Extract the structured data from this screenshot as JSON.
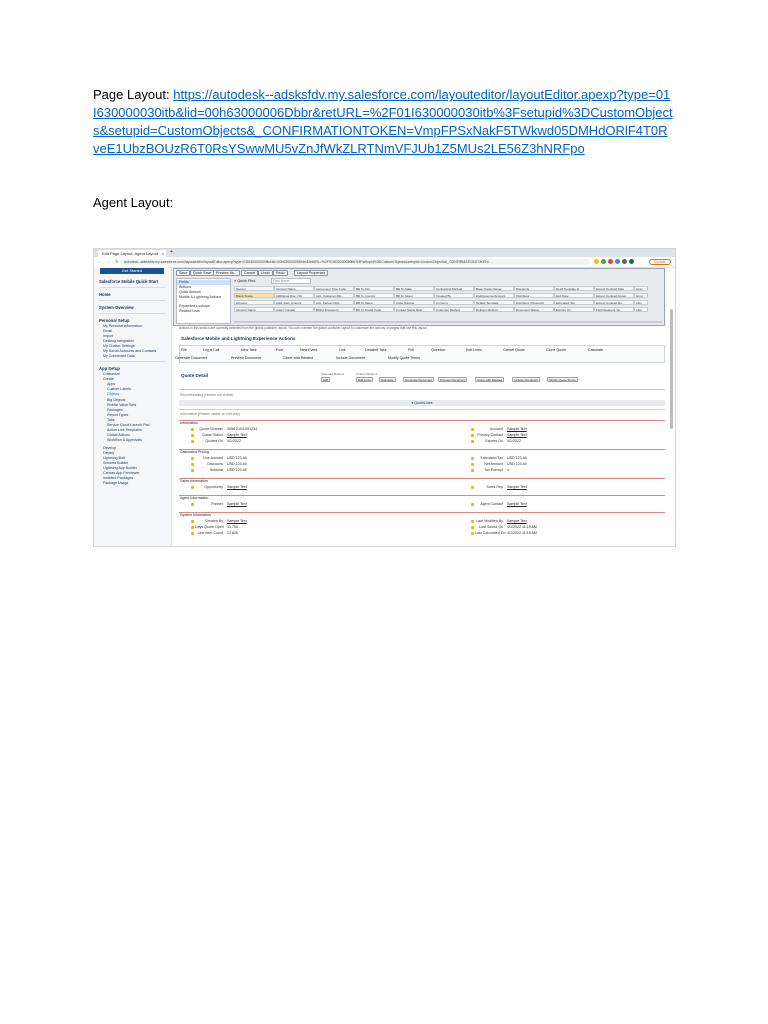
{
  "doc": {
    "page_layout_label": "Page Layout:",
    "page_layout_url": "https://autodesk--adsksfdv.my.salesforce.com/layouteditor/layoutEditor.apexp?type=01I630000030itb&lid=00h63000006Dbbr&retURL=%2F01I630000030itb%3Fsetupid%3DCustomObjects&setupid=CustomObjects&_CONFIRMATIONTOKEN=VmpFPSxNakF5TWkwd05DMHdORlF4T0RveE1UbzBOUzR6T0RsYSwwMU5vZnJfWkZLRTNmVFJUb1Z5MUs2LE56Z3hNRFpo",
    "agent_layout_label": "Agent Layout:"
  },
  "screenshot": {
    "tab_title": "Edit Page Layout: Agent Layout",
    "url": "autodesk--adsksfdv.my.salesforce.com/layouteditor/layoutEditor.apexp?type=01I630000030itb&lid=00h63000006Dbbr&retURL=%2F01I630000030itb%3Fsetupid%3DCustomObjects&setupid=CustomObjects&_CONFIRMATIONTOKEN=...",
    "update_label": "Update",
    "sidebar": {
      "get_started": "Get Started",
      "mobile_quick_start": "Salesforce Mobile Quick Start",
      "home": "Home",
      "system_overview": "System Overview",
      "personal_setup": "Personal Setup",
      "personal_items": [
        "My Personal Information",
        "Email",
        "Import",
        "Desktop Integration",
        "My Chatter Settings",
        "My Social Accounts and Contacts",
        "My Connected Data"
      ],
      "app_setup": "App Setup",
      "app_items": [
        "Customize",
        "Create"
      ],
      "create_items": [
        "Apps",
        "Custom Labels",
        "Objects",
        "Big Objects",
        "Picklist Value Sets",
        "Packages",
        "Report Types",
        "Tabs",
        "Service Cloud Launch Pad",
        "Action Link Templates",
        "Global Actions",
        "Workflow & Approvals"
      ],
      "more_items": [
        "Develop",
        "Deploy",
        "Lightning Bolt",
        "Schema Builder",
        "Lightning App Builder",
        "Canvas App Previewer",
        "Installed Packages",
        "Package Usage"
      ]
    },
    "palette": {
      "toolbar": [
        "Save",
        "Quick Save",
        "Preview As...",
        "Cancel",
        "Undo",
        "Redo",
        "Layout Properties"
      ],
      "categories": [
        "Fields",
        "Buttons",
        "Quick Actions",
        "Mobile & Lightning Actions",
        "Expanded Lookups",
        "Related Lists"
      ],
      "quick_find_label": "Quick Find",
      "quick_find_placeholder": "Field Name",
      "fields": [
        [
          "Section",
          "Account Name",
          "Agreement Type Code",
          "Bill To City",
          "Bill To State",
          "Contracting Method",
          "Base Quote Owner",
          "Discounts",
          "Doc# Template Id",
          "Expect Contract Flag",
          "Gran"
        ],
        [
          "Blank Space",
          "Additional Disc. (%)",
          "Avg. Customer Dis...",
          "Bill To Country",
          "Bill To Street",
          "Created By",
          "EndCustomerAccount",
          "Distributor",
          "End Date",
          "Expect Contract Notes",
          "Grou"
        ],
        [
          "Account",
          "Addl. Disc. Amount",
          "Avg. Partner Disc...",
          "Bill To Name",
          "Case Number",
          "Currency",
          "Default Template",
          "Distributor (Discount)",
          "Estimated Tax",
          "Expect Contract Ru...",
          "Inbo"
        ],
        [
          "Account Name",
          "Agent Contact",
          "Billing Frequency",
          "Bill To Postal Code",
          "Contact Name Rest...",
          "Customer Method",
          "Delivery Method",
          "Document Status",
          "Expires On",
          "Field Segment Ter...",
          "Inbo"
        ]
      ]
    },
    "info_banner": "Actions in this section are currently inherited from the global publisher layout. You can override the global publisher layout to customize the actions on pages that use this layout.",
    "actions_title": "Salesforce Mobile and Lightning Experience Actions",
    "actions_row1": [
      "File",
      "Log a Call",
      "New Task",
      "Post",
      "New Event",
      "Link",
      "Detailed Task",
      "Poll",
      "Question",
      "Edit Lines",
      "Cancel Quote",
      "Clone Quote",
      "Calculate"
    ],
    "actions_row2": [
      "Generate Document",
      "Preview Document",
      "Clone with Related",
      "Include Document",
      "Modify Quote Terms"
    ],
    "quote_detail_title": "Quote Detail",
    "standard_buttons_label": "Standard Buttons",
    "custom_buttons_label": "Custom Buttons",
    "standard_buttons": [
      "Edit"
    ],
    "custom_buttons": [
      "Edit Lines",
      "Calculate",
      "Generate Document",
      "Preview Document",
      "Clone with Related",
      "Include Document",
      "Modify Quote Terms"
    ],
    "section_unnamed": "Recordheading (Header not visible)",
    "quotelines_bar": "QuoteLines",
    "section_info_hidden": "Information (Header visible on edit only)",
    "sections": [
      {
        "title": "Information",
        "left": [
          [
            "Quote Number",
            "0096 2104-001234"
          ],
          [
            "Quote Status",
            "Sample Text"
          ],
          [
            "Quoted On",
            "4/1/2022"
          ]
        ],
        "right": [
          [
            "Account",
            "Sample Text"
          ],
          [
            "Primary Contact",
            "Sample Text"
          ],
          [
            "Expires On",
            "4/1/2022"
          ]
        ]
      },
      {
        "title": "Calculated Pricing",
        "left": [
          [
            "Line Amount",
            "USD 123.45"
          ],
          [
            "Discounts",
            "USD 123.45"
          ],
          [
            "Subtotal",
            "USD 123.45"
          ]
        ],
        "right": [
          [
            "Estimated Tax",
            "USD 123.45"
          ],
          [
            "Net Amount",
            "USD 123.45"
          ],
          [
            "Tax Exempt",
            "✔"
          ]
        ]
      },
      {
        "title": "Sales Information",
        "left": [
          [
            "Opportunity",
            "Sample Text"
          ]
        ],
        "right": [
          [
            "Sales Rep",
            "Sample Text"
          ]
        ]
      },
      {
        "title": "Agent Information",
        "left": [
          [
            "Partner",
            "Sample Text"
          ]
        ],
        "right": [
          [
            "Agent Contact",
            "Sample Text"
          ]
        ]
      },
      {
        "title": "System Information",
        "left": [
          [
            "Created By",
            "Sample Text"
          ],
          [
            "Days Quote Open",
            "31,750"
          ],
          [
            "Line Item Count",
            "12,626"
          ]
        ],
        "right": [
          [
            "Last Modified By",
            "Sample Text"
          ],
          [
            "Last Saved On",
            "4/1/2022 11:19 AM"
          ],
          [
            "Last Calculated On",
            "4/1/2022 11:19 AM"
          ]
        ]
      }
    ]
  }
}
